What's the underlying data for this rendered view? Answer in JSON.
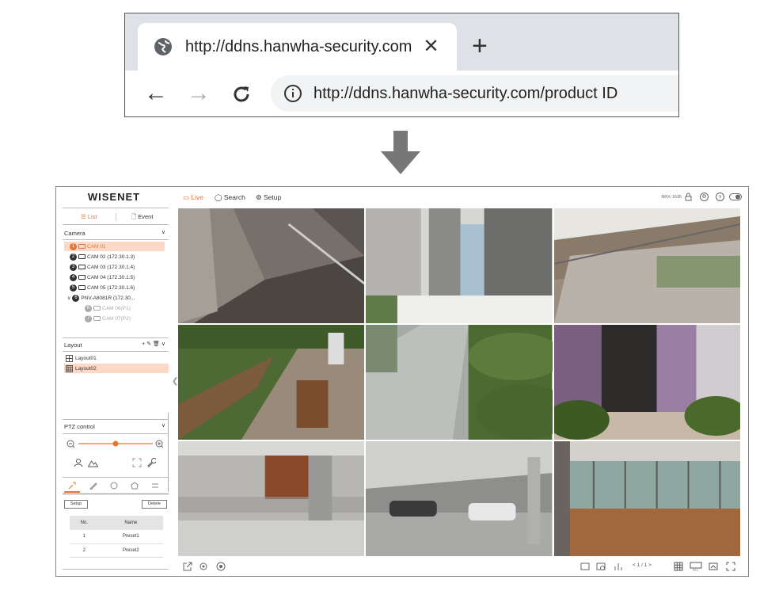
{
  "browser": {
    "tab_title": "http://ddns.hanwha-security.com",
    "tab_close": "✕",
    "new_tab": "+",
    "back": "←",
    "forward": "→",
    "reload": "C",
    "url": "http://ddns.hanwha-security.com/product ID"
  },
  "app": {
    "logo": "WISENET",
    "left_tabs": {
      "list": "List",
      "event": "Event"
    },
    "camera_section": "Camera",
    "cameras": [
      {
        "num": "1",
        "label": "CAM 01",
        "selected": true
      },
      {
        "num": "2",
        "label": "CAM 02 (172.30.1.3)"
      },
      {
        "num": "3",
        "label": "CAM 03 (172.30.1.4)"
      },
      {
        "num": "4",
        "label": "CAM 04 (172.30.1.5)"
      },
      {
        "num": "5",
        "label": "CAM 05 (172.30.1.6)"
      },
      {
        "num": "6",
        "label": "PNV-A8081R (172.30..."
      },
      {
        "num": "6",
        "label": "CAM 06(P1)",
        "dim": true
      },
      {
        "num": "7",
        "label": "CAM 07(P2)",
        "dim": true
      }
    ],
    "layout_section": "Layout",
    "layout_tools": "+ ✎ 🗑 ∨",
    "layouts": [
      "Layout01",
      "Layout02"
    ],
    "ptz_section": "PTZ control",
    "ptz_setup": "Setup",
    "ptz_delete": "Delete",
    "preset_headers": [
      "No.",
      "Name"
    ],
    "presets": [
      {
        "no": "1",
        "name": "Preset1"
      },
      {
        "no": "2",
        "name": "Preset2"
      }
    ],
    "nav": {
      "live": "Live",
      "search": "Search",
      "setup": "Setup"
    },
    "model": "NRX-1635",
    "pager": "< 1 / 1 >"
  },
  "colors": {
    "accent": "#e8742f",
    "selection_bg": "#fbd9c6"
  }
}
